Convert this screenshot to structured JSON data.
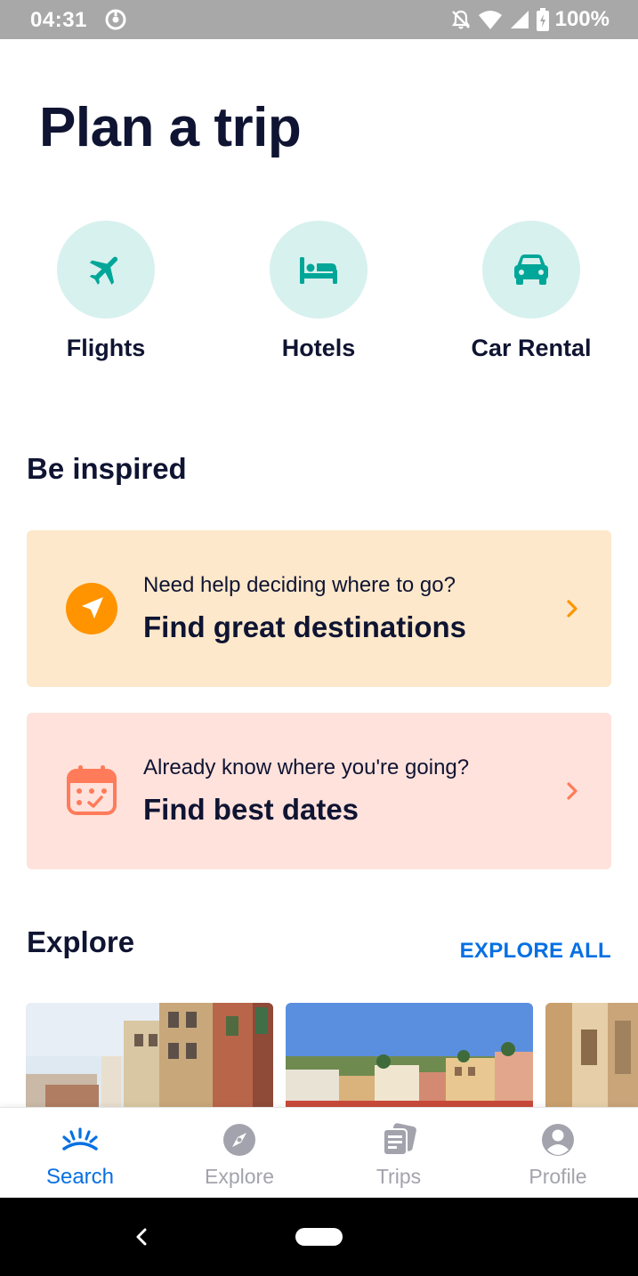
{
  "status_bar": {
    "time": "04:31",
    "battery": "100%",
    "icons": [
      "sync-icon",
      "mute-icon",
      "wifi-icon",
      "signal-icon",
      "battery-icon"
    ]
  },
  "page": {
    "title": "Plan a trip"
  },
  "categories": [
    {
      "label": "Flights",
      "icon": "airplane-icon"
    },
    {
      "label": "Hotels",
      "icon": "bed-icon"
    },
    {
      "label": "Car Rental",
      "icon": "car-icon"
    }
  ],
  "inspire": {
    "title": "Be inspired",
    "cards": [
      {
        "subtitle": "Need help deciding where to go?",
        "title": "Find great destinations",
        "icon": "compass-arrow-icon",
        "color": "#fde8cb"
      },
      {
        "subtitle": "Already know where you're going?",
        "title": "Find best dates",
        "icon": "calendar-icon",
        "color": "#ffe2dc"
      }
    ]
  },
  "explore": {
    "title": "Explore",
    "link": "EXPLORE ALL"
  },
  "bottom_nav": {
    "items": [
      {
        "label": "Search",
        "icon": "sunrise-icon",
        "active": true
      },
      {
        "label": "Explore",
        "icon": "compass-icon",
        "active": false
      },
      {
        "label": "Trips",
        "icon": "tickets-icon",
        "active": false
      },
      {
        "label": "Profile",
        "icon": "person-icon",
        "active": false
      }
    ]
  },
  "colors": {
    "accent": "#0770e3",
    "teal": "#00a698",
    "orange": "#ff9400",
    "coral": "#ff7b59",
    "text": "#0f1432"
  }
}
